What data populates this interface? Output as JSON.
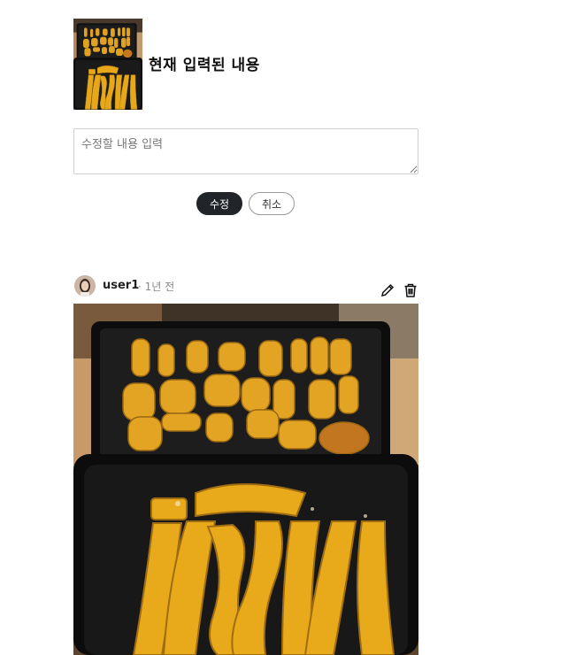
{
  "edit": {
    "title": "현재 입력된 내용",
    "textarea_placeholder": "수정할 내용 입력",
    "save_label": "수정",
    "cancel_label": "취소"
  },
  "post": {
    "author": "user1",
    "time": "· 1년 전",
    "image_alt": "roasted squash on baking trays"
  },
  "icons": {
    "edit": "pencil-icon",
    "delete": "trash-icon"
  }
}
